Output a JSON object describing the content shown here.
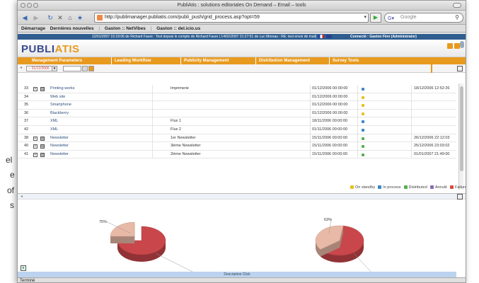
{
  "left_fragment": [
    "el",
    "e",
    "of",
    "s"
  ],
  "window": {
    "title": "PubliAtis : solutions editoriales On Demand – Email – tools"
  },
  "toolbar": {
    "url": "http://publimanager.publiatis.com/publi_push/grid_process.asp?opt=59",
    "search_placeholder": "Google"
  },
  "bookmarks": [
    "Démarrage",
    "Dernières nouvelles",
    "Gaston :: NetVibes",
    "Gaston :: del.icio.us"
  ],
  "app": {
    "info": "12/01/2007 15:19:06 de Richard Faure : Test depuis le compte de Richard Faure | 14/02/2007 21:27:51 de Luc Moreau : RE: test envoi de mail| ",
    "connected": "Connecté : Gaston Finn (Administrator)",
    "logo_part1": "PUBLI",
    "logo_part2": "ATIS",
    "menu": [
      "Management Parameters",
      "Leading Workflow",
      "Publicity Management",
      "Distribution Management",
      "Survey Tools"
    ],
    "filter_date": "-- 01/12/2006"
  },
  "grid": {
    "rows": [
      {
        "id": "33",
        "tree": true,
        "name": "Printing works",
        "desc": "Imprimerie",
        "date": "01/12/2006 00:00:00",
        "status": "blue",
        "done": "18/12/2006 12:52:26"
      },
      {
        "id": "34",
        "tree": false,
        "name": "Web site",
        "desc": "",
        "date": "01/12/2006 00:00:00",
        "status": "yellow",
        "done": ""
      },
      {
        "id": "35",
        "tree": false,
        "name": "Smartphone",
        "desc": "",
        "date": "01/12/2006 00:00:00",
        "status": "yellow",
        "done": ""
      },
      {
        "id": "36",
        "tree": false,
        "name": "Blackberry",
        "desc": "",
        "date": "01/12/2006 00:00:00",
        "status": "yellow",
        "done": ""
      },
      {
        "id": "37",
        "tree": false,
        "name": "XML",
        "desc": "Flux 1",
        "date": "18/11/2006 00:00:00",
        "status": "blue",
        "done": ""
      },
      {
        "id": "42",
        "tree": false,
        "name": "XML",
        "desc": "Flux 2",
        "date": "01/11/2006 00:00:00",
        "status": "blue",
        "done": ""
      },
      {
        "id": "38",
        "tree": true,
        "name": "Newsletter",
        "desc": "1er Newsletter",
        "date": "15/11/2006 00:00:00",
        "status": "green",
        "done": "26/12/2006 22:12:03"
      },
      {
        "id": "40",
        "tree": true,
        "name": "Newsletter",
        "desc": "3ième Newsletter",
        "date": "15/11/2006 00:00:00",
        "status": "green",
        "done": "25/12/2006 23:03:02"
      },
      {
        "id": "41",
        "tree": true,
        "name": "Newsletter",
        "desc": "2ième Newsletter",
        "date": "15/11/2006 00:00:00",
        "status": "green",
        "done": "01/01/2007 21:49:00"
      }
    ]
  },
  "legend": [
    {
      "label": "On standby",
      "color": "#e8c020"
    },
    {
      "label": "In process",
      "color": "#3a86c8"
    },
    {
      "label": "Distributed",
      "color": "#58b050"
    },
    {
      "label": "Annulé",
      "color": "#8a6ab8"
    },
    {
      "label": "Failure",
      "color": "#d84a3a"
    }
  ],
  "chart_data": [
    {
      "type": "pie",
      "values": [
        75,
        25
      ],
      "labels": [
        "75%",
        "25%"
      ],
      "colors": [
        "#c9474b",
        "#e8b9a6"
      ]
    },
    {
      "type": "pie",
      "values": [
        63,
        38
      ],
      "labels": [
        "63%",
        "38%"
      ],
      "colors": [
        "#c9474b",
        "#e8b9a6"
      ]
    }
  ],
  "bottom_bar": "Description Click",
  "status": "Terminé"
}
